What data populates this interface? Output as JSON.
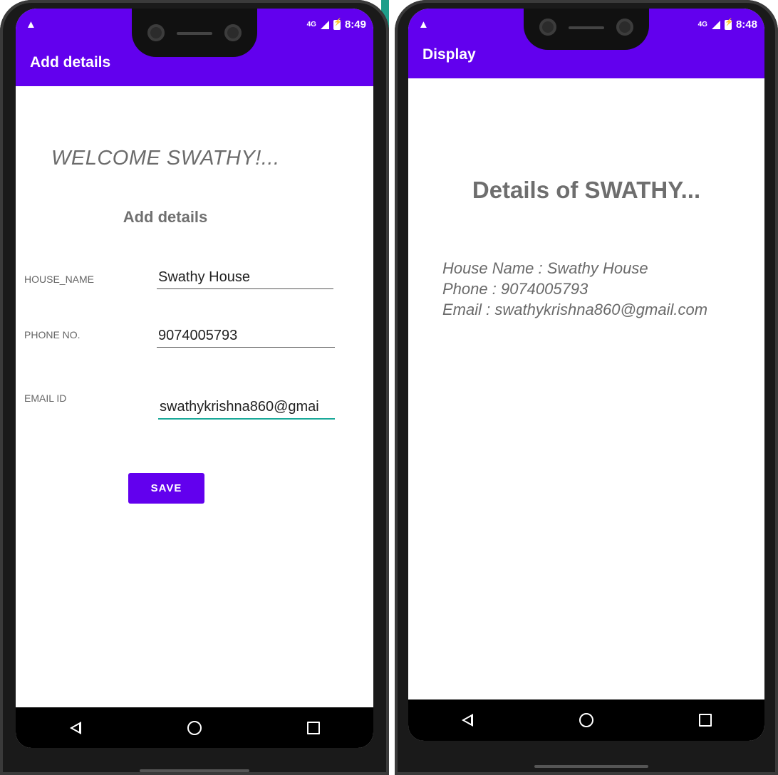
{
  "left_phone": {
    "status": {
      "warning": "▲",
      "network": "4G",
      "time": "8:49"
    },
    "appbar": {
      "title": "Add details"
    },
    "welcome": "WELCOME SWATHY!...",
    "heading": "Add details",
    "fields": [
      {
        "label": "HOUSE_NAME",
        "value": "Swathy House"
      },
      {
        "label": "PHONE NO.",
        "value": "9074005793"
      },
      {
        "label": "EMAIL ID",
        "value": "swathykrishna860@gmai"
      }
    ],
    "save_label": "SAVE"
  },
  "right_phone": {
    "status": {
      "warning": "▲",
      "network": "4G",
      "time": "8:48"
    },
    "appbar": {
      "title": "Display"
    },
    "heading": "Details of SWATHY...",
    "lines": [
      "House Name : Swathy House",
      "Phone : 9074005793",
      "Email : swathykrishna860@gmail.com"
    ]
  },
  "colors": {
    "primary": "#6200ee",
    "accent": "#1aa999",
    "text_gray": "#6e6e6e"
  }
}
